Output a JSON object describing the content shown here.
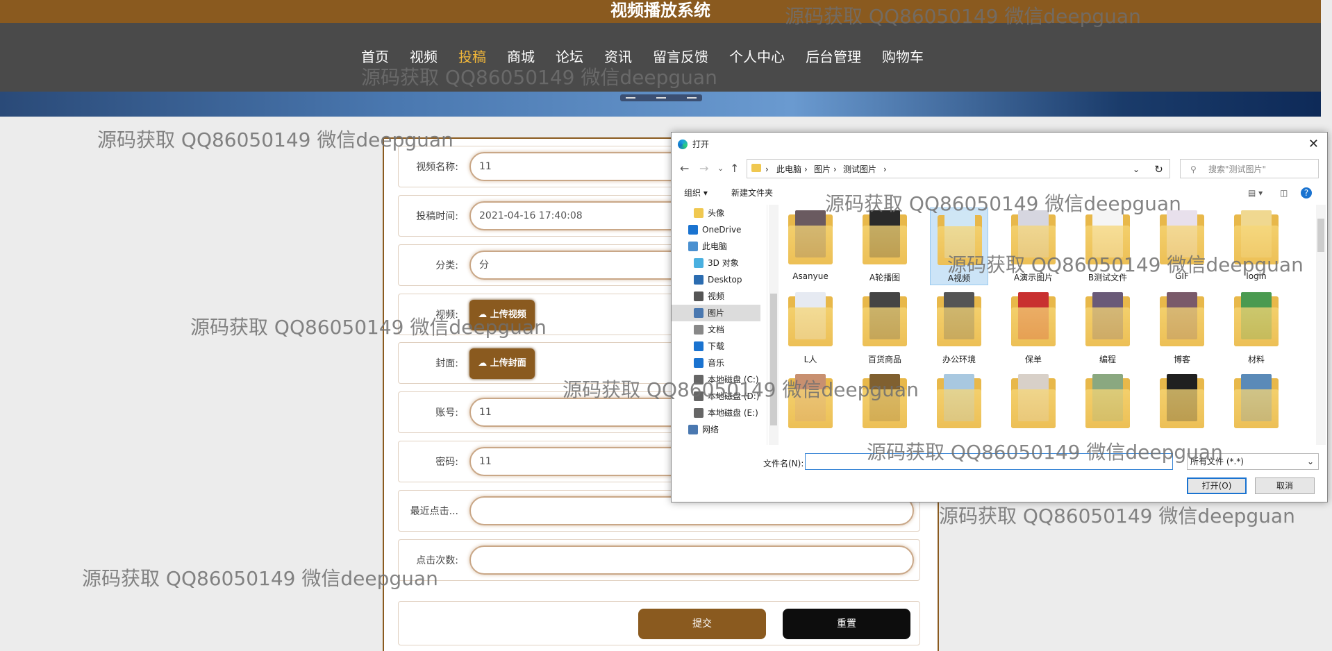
{
  "site_title": "视频播放系统",
  "nav": [
    "首页",
    "视频",
    "投稿",
    "商城",
    "论坛",
    "资讯",
    "留言反馈",
    "个人中心",
    "后台管理",
    "购物车"
  ],
  "nav_active": "投稿",
  "form": {
    "rows": [
      {
        "label": "视频名称:",
        "value": "11"
      },
      {
        "label": "投稿时间:",
        "value": "2021-04-16 17:40:08"
      },
      {
        "label": "分类:",
        "value": "分"
      },
      {
        "label": "视频:",
        "button": "上传视频"
      },
      {
        "label": "封面:",
        "button": "上传封面"
      },
      {
        "label": "账号:",
        "value": "11"
      },
      {
        "label": "密码:",
        "value": "11"
      },
      {
        "label": "最近点击...",
        "value": ""
      },
      {
        "label": "点击次数:",
        "value": ""
      }
    ],
    "submit": "提交",
    "reset": "重置"
  },
  "dialog": {
    "title": "打开",
    "breadcrumb": [
      "此电脑",
      "图片",
      "测试图片"
    ],
    "search_placeholder": "搜索\"测试图片\"",
    "organize": "组织 ▾",
    "new_folder": "新建文件夹",
    "sidebar": [
      "头像",
      "OneDrive",
      "此电脑",
      "3D 对象",
      "Desktop",
      "视频",
      "图片",
      "文档",
      "下载",
      "音乐",
      "本地磁盘 (C:)",
      "本地磁盘 (D:)",
      "本地磁盘 (E:)",
      "网络"
    ],
    "sidebar_selected": "图片",
    "files": [
      "Asanyue",
      "A轮播图",
      "A视频",
      "A演示图片",
      "B测试文件",
      "GIF",
      "login",
      "L人",
      "百货商品",
      "办公环境",
      "保单",
      "编程",
      "博客",
      "材料",
      "",
      "",
      "",
      "",
      "",
      "",
      ""
    ],
    "selected_file": "A视频",
    "filename_label": "文件名(N):",
    "filetype": "所有文件 (*.*)",
    "open": "打开(O)",
    "cancel": "取消"
  },
  "watermark": "源码获取 QQ86050149 微信deepguan"
}
